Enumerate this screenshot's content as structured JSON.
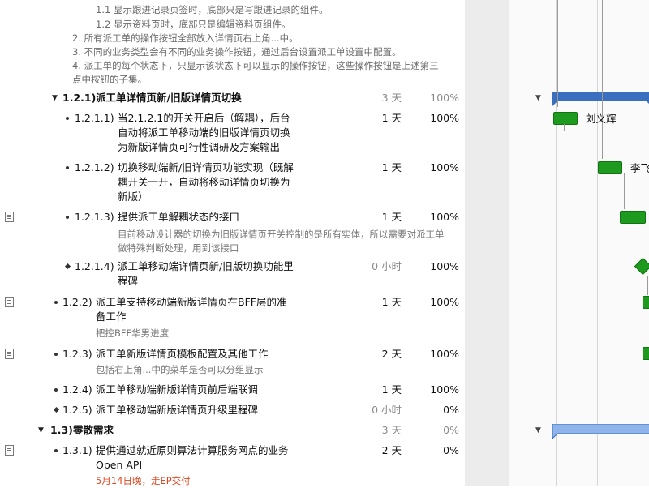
{
  "notes": [
    "1.1 显示跟进记录页签时，底部只是写跟进记录的组件。",
    "1.2 显示资料页时，底部只是编辑资料页组件。",
    "2. 所有派工单的操作按钮全部放入详情页右上角...中。",
    "3. 不同的业务类型会有不同的业务操作按钮，通过后台设置派工单设置中配置。",
    "4. 派工单的每个状态下，只显示该状态下可以显示的操作按钮，这些操作按钮是上述第三",
    "点中按钮的子集。"
  ],
  "tasks": [
    {
      "num": "1.2.1)",
      "title": [
        "派工单详情页新/旧版详情页切换"
      ],
      "dur": "3 天",
      "pct": "100%"
    },
    {
      "num": "1.2.1.1)",
      "title": [
        "当2.1.2.1的开关开启后（解耦），后台",
        "自动将派工单移动端的旧版详情页切换",
        "为新版详情页可行性调研及方案输出"
      ],
      "dur": "1 天",
      "pct": "100%"
    },
    {
      "num": "1.2.1.2)",
      "title": [
        "切换移动端新/旧详情页功能实现（既解",
        "耦开关一开，自动将移动详情页切换为",
        "新版）"
      ],
      "dur": "1 天",
      "pct": "100%"
    },
    {
      "num": "1.2.1.3)",
      "title": [
        "提供派工单解耦状态的接口"
      ],
      "dur": "1 天",
      "pct": "100%",
      "note": [
        "目前移动设计器的切换为旧版详情页开关控制的是所有实体，所以需要对派工单",
        "做特殊判断处理，用到该接口"
      ]
    },
    {
      "num": "1.2.1.4)",
      "title": [
        "派工单移动端详情页新/旧版切换功能里",
        "程碑"
      ],
      "dur": "0 小时",
      "pct": "100%"
    },
    {
      "num": "1.2.2)",
      "title": [
        "派工单支持移动端新版详情页在BFF层的准",
        "备工作"
      ],
      "dur": "1 天",
      "pct": "100%",
      "note": [
        "把控BFF华男进度"
      ]
    },
    {
      "num": "1.2.3)",
      "title": [
        "派工单新版详情页模板配置及其他工作"
      ],
      "dur": "2 天",
      "pct": "100%",
      "note": [
        "包括右上角...中的菜单是否可以分组显示"
      ]
    },
    {
      "num": "1.2.4)",
      "title": [
        "派工单移动端新版详情页前后端联调"
      ],
      "dur": "1 天",
      "pct": "100%"
    },
    {
      "num": "1.2.5)",
      "title": [
        "派工单移动端新版详情页升级里程碑"
      ],
      "dur": "0 小时",
      "pct": "0%"
    },
    {
      "num": "1.3)",
      "title": [
        "零散需求"
      ],
      "dur": "3 天",
      "pct": "0%"
    },
    {
      "num": "1.3.1)",
      "title": [
        "提供通过就近原则算法计算服务网点的业务",
        "Open API"
      ],
      "dur": "2 天",
      "pct": "0%",
      "note": [
        "5月14日晚，走EP交付"
      ]
    }
  ],
  "gantt": {
    "resources": [
      "刘义辉",
      "李飞"
    ]
  },
  "colors": {
    "task_bar": "#1e9a1e",
    "summary_bar": "#3a6fc0",
    "summary_bar_light": "#8fb4ea",
    "note_red": "#e0461f"
  }
}
